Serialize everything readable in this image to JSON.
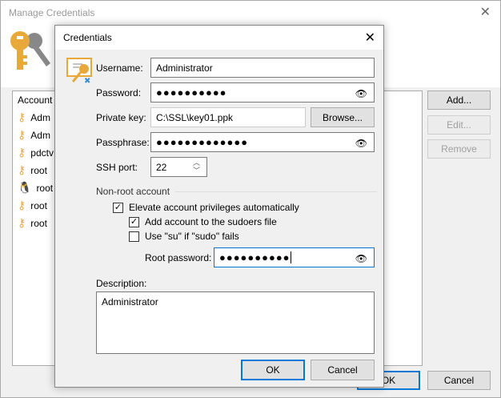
{
  "outer": {
    "title": "Manage Credentials",
    "list_header": "Account",
    "accounts": [
      {
        "icon": "key-icon",
        "label": "Adm"
      },
      {
        "icon": "key-icon",
        "label": "Adm"
      },
      {
        "icon": "key-icon",
        "label": "pdctv"
      },
      {
        "icon": "key-icon",
        "label": "root"
      },
      {
        "icon": "linux-icon",
        "label": "root"
      },
      {
        "icon": "key-icon",
        "label": "root"
      },
      {
        "icon": "key-icon",
        "label": "root"
      }
    ],
    "add": "Add...",
    "edit": "Edit...",
    "remove": "Remove",
    "ok": "OK",
    "cancel": "Cancel"
  },
  "dialog": {
    "title": "Credentials",
    "username_label": "Username:",
    "username": "Administrator",
    "password_label": "Password:",
    "password": "●●●●●●●●●●",
    "private_key_label": "Private key:",
    "private_key": "C:\\SSL\\key01.ppk",
    "browse": "Browse...",
    "passphrase_label": "Passphrase:",
    "passphrase": "●●●●●●●●●●●●●",
    "ssh_port_label": "SSH port:",
    "ssh_port": "22",
    "nonroot_label": "Non-root account",
    "elevate": "Elevate account privileges automatically",
    "elevate_checked": true,
    "sudoers": "Add account to the sudoers file",
    "sudoers_checked": true,
    "su": "Use \"su\" if \"sudo\" fails",
    "su_checked": false,
    "root_password_label": "Root password:",
    "root_password": "●●●●●●●●●●",
    "description_label": "Description:",
    "description": "Administrator",
    "ok": "OK",
    "cancel": "Cancel"
  },
  "colors": {
    "accent": "#0078d7",
    "key": "#e8a93a"
  }
}
